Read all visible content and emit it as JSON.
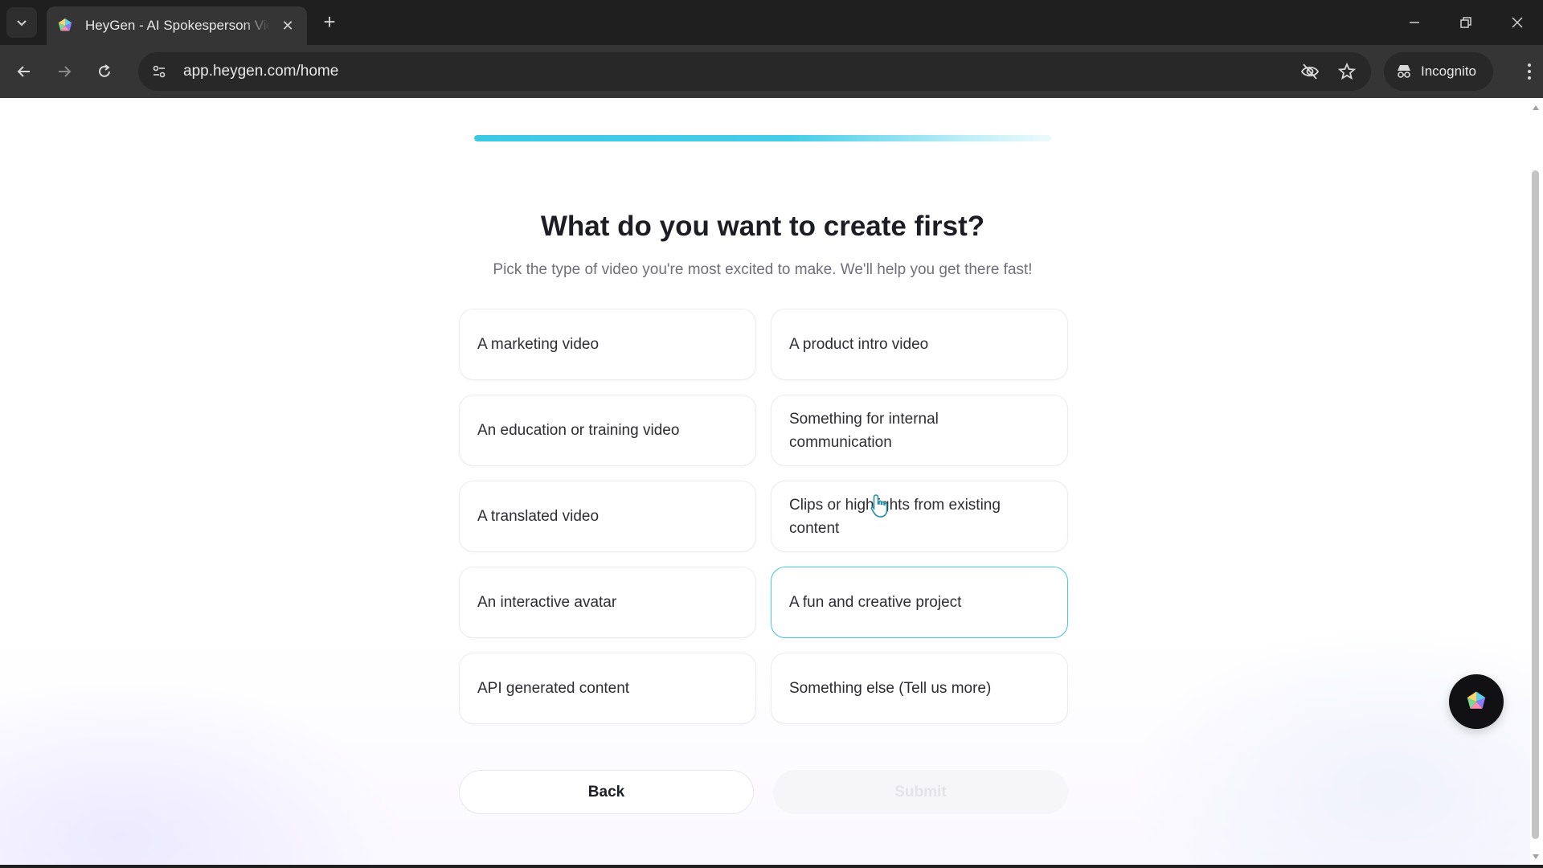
{
  "browser": {
    "tab_title": "HeyGen - AI Spokesperson Vide",
    "tab_close": "✕",
    "new_tab": "+",
    "url": "app.heygen.com/home",
    "incognito_label": "Incognito"
  },
  "page": {
    "progress_percent": 100,
    "title": "What do you want to create first?",
    "subtitle": "Pick the type of video you're most excited to make. We'll help you get there fast!",
    "options": [
      {
        "label": "A marketing video"
      },
      {
        "label": "A product intro video"
      },
      {
        "label": "An education or training video"
      },
      {
        "label": "Something for internal communication"
      },
      {
        "label": "A translated video"
      },
      {
        "label": "Clips or highlights from existing content"
      },
      {
        "label": "An interactive avatar"
      },
      {
        "label": "A fun and creative project"
      },
      {
        "label": "API generated content"
      },
      {
        "label": "Something else (Tell us more)"
      }
    ],
    "selected_option": "A fun and creative project",
    "back_label": "Back",
    "submit_label": "Submit"
  },
  "colors": {
    "accent": "#49c7dc",
    "heading": "#1d1d24",
    "chrome_dark": "#1f1f1f"
  },
  "icons": {
    "favicon": "heygen-logo-icon",
    "chat": "heygen-logo-icon",
    "cursor": "hand-pointer-icon"
  }
}
